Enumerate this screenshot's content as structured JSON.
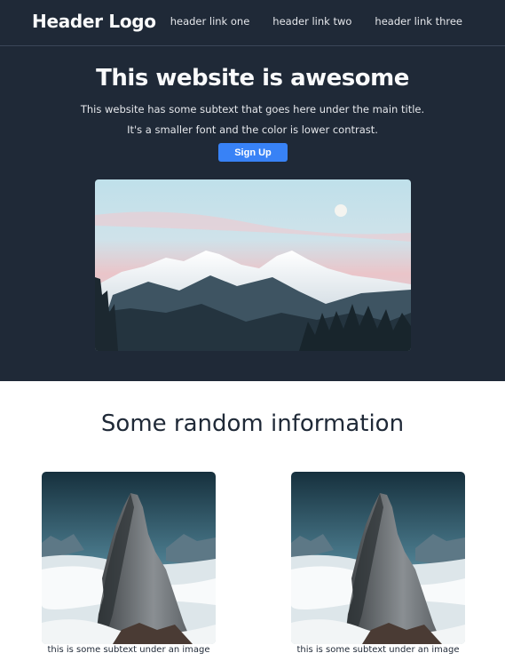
{
  "header": {
    "logo": "Header Logo",
    "links": [
      "header link one",
      "header link two",
      "header link three"
    ]
  },
  "hero": {
    "title": "This website is awesome",
    "subtitle_line1": "This website has some subtext that goes here under the main title.",
    "subtitle_line2": "It's a smaller font and the color is lower contrast.",
    "button_label": "Sign Up",
    "image_icon": "mountain-landscape-image"
  },
  "info": {
    "title": "Some random information",
    "cards": [
      {
        "caption": "this is some subtext under an image",
        "image_icon": "rock-peak-image"
      },
      {
        "caption": "this is some subtext under an image",
        "image_icon": "rock-peak-image"
      }
    ]
  },
  "colors": {
    "dark_bg": "#1f2937",
    "button": "#3882f6",
    "light_text": "#f9fafb"
  }
}
